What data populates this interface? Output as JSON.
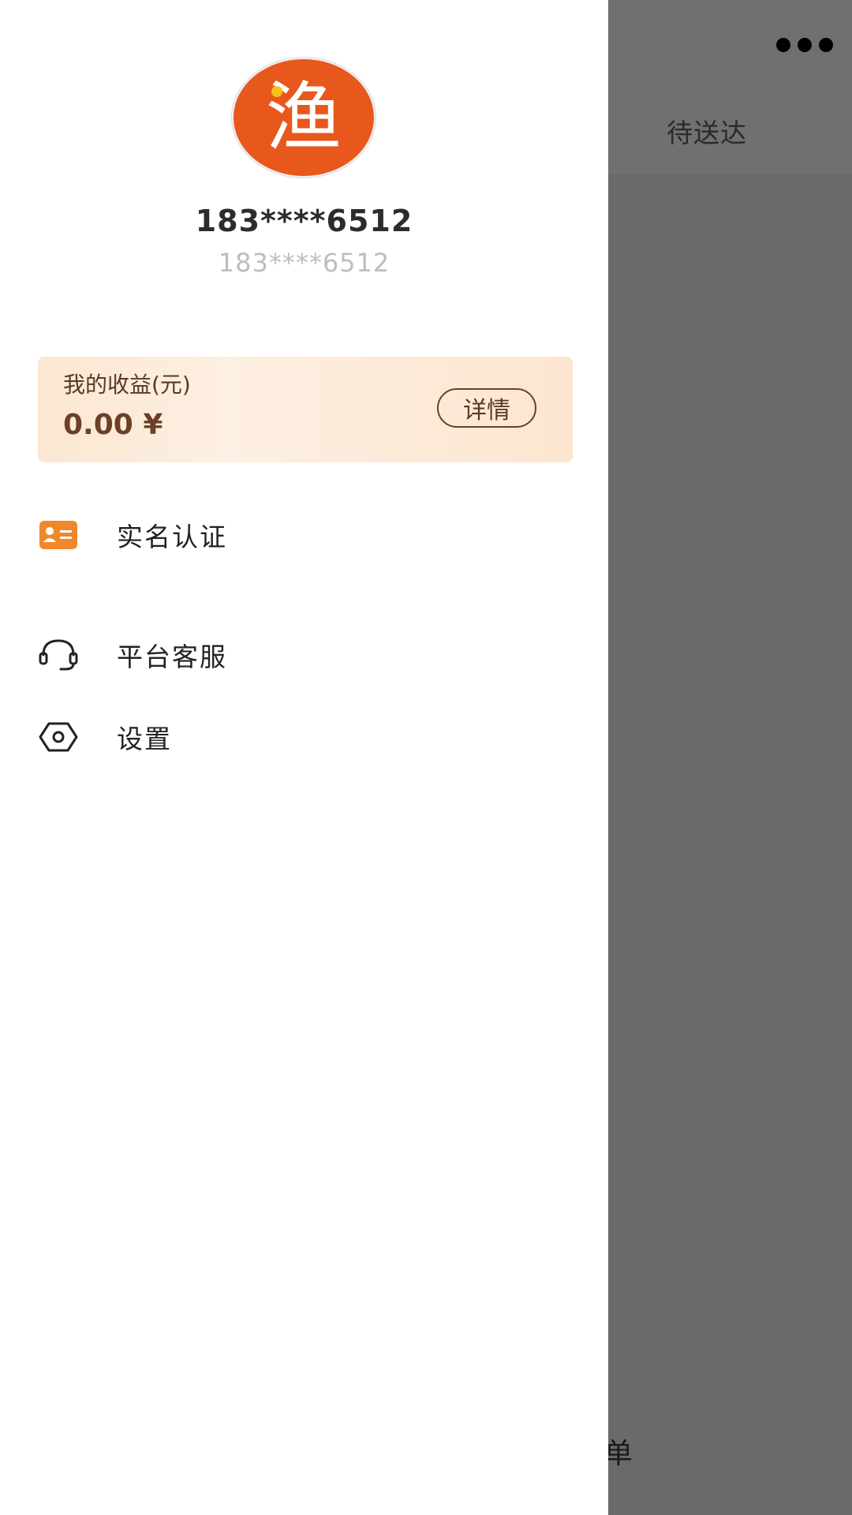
{
  "background": {
    "tab_pending": "待送达",
    "bottom_partial_text": "单",
    "more_icon": "more-dots-icon"
  },
  "drawer": {
    "avatar": {
      "char": "渔",
      "color": "#e8581c"
    },
    "user_name": "183****6512",
    "user_sub": "183****6512",
    "earnings": {
      "label": "我的收益(元)",
      "value": "0.00 ¥",
      "detail_label": "详情"
    },
    "menu": [
      {
        "label": "实名认证",
        "icon": "id-card-icon"
      },
      {
        "label": "平台客服",
        "icon": "headset-icon"
      },
      {
        "label": "设置",
        "icon": "settings-hexagon-icon"
      }
    ]
  },
  "colors": {
    "accent": "#e8581c",
    "card_text": "#6b4026",
    "overlay": "#6a6a6a"
  }
}
